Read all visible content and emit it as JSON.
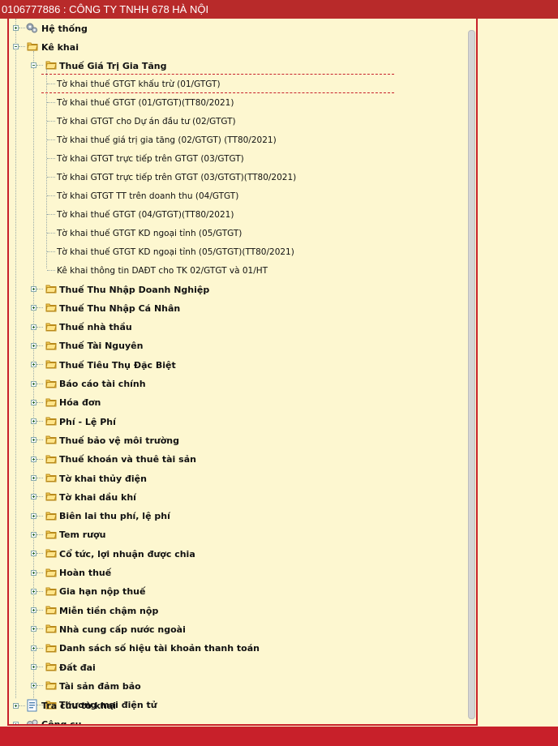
{
  "window": {
    "title": "0106777886 : CÔNG TY TNHH 678 HÀ NỘI"
  },
  "tree": {
    "he_thong": "Hệ thống",
    "ke_khai": "Kê khai",
    "gtgt": {
      "label": "Thuế Giá Trị Gia Tăng",
      "items": [
        "Tờ khai thuế GTGT khấu trừ (01/GTGT)",
        "Tờ khai thuế GTGT (01/GTGT)(TT80/2021)",
        "Tờ khai GTGT cho Dự án đầu tư (02/GTGT)",
        "Tờ khai thuế giá trị gia tăng (02/GTGT) (TT80/2021)",
        "Tờ khai GTGT trực tiếp trên GTGT (03/GTGT)",
        "Tờ khai GTGT trực tiếp trên GTGT (03/GTGT)(TT80/2021)",
        "Tờ khai GTGT TT trên doanh thu (04/GTGT)",
        "Tờ khai thuế GTGT (04/GTGT)(TT80/2021)",
        "Tờ khai thuế GTGT KD ngoại tỉnh (05/GTGT)",
        "Tờ khai thuế GTGT KD ngoại tỉnh (05/GTGT)(TT80/2021)",
        "Kê khai thông tin DAĐT cho TK 02/GTGT và 01/HT"
      ]
    },
    "groups": [
      "Thuế Thu Nhập Doanh Nghiệp",
      "Thuế Thu Nhập Cá Nhân",
      "Thuế nhà thầu",
      "Thuế Tài Nguyên",
      "Thuế Tiêu Thụ Đặc Biệt",
      "Báo cáo tài chính",
      "Hóa đơn",
      "Phí - Lệ Phí",
      "Thuế bảo vệ môi trường",
      "Thuế khoán và thuê tài sản",
      "Tờ khai thủy điện",
      "Tờ khai dầu khí",
      "Biên lai thu phí, lệ phí",
      "Tem rượu",
      "Cổ tức, lợi nhuận được chia",
      "Hoàn thuế",
      "Gia hạn nộp thuế",
      "Miễn tiền chậm nộp",
      "Nhà cung cấp nước ngoài",
      "Danh sách số hiệu tài khoản thanh toán",
      "Đất đai",
      "Tài sản đảm bảo",
      "Thương mại điện tử"
    ],
    "tra_cuu": "Tra cứu tờ khai",
    "cong_cu": "Công cụ"
  },
  "colors": {
    "titlebar": "#b82a2a",
    "panel_bg": "#fdf7d0",
    "accent": "#c8202a"
  },
  "icons": {
    "folder": "folder-icon",
    "gear": "gear-icon",
    "document": "document-icon",
    "tools": "tools-icon",
    "expand": "plus-icon"
  }
}
